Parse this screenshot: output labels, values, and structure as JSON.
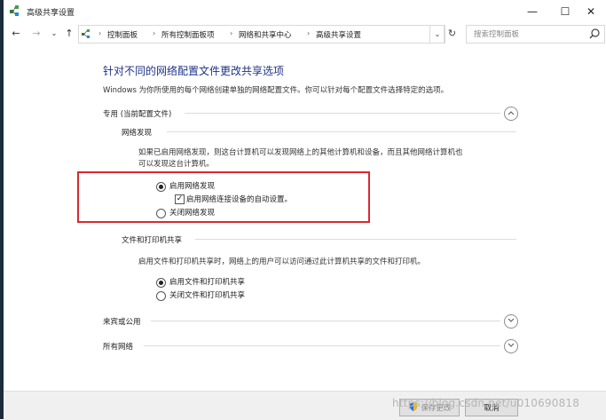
{
  "window": {
    "title": "高级共享设置",
    "controls": {
      "minimize": "—",
      "maximize": "☐",
      "close": "✕"
    }
  },
  "address_bar": {
    "breadcrumbs": [
      "控制面板",
      "所有控制面板项",
      "网络和共享中心",
      "高级共享设置"
    ],
    "search_placeholder": "搜索控制面板"
  },
  "main": {
    "heading": "针对不同的网络配置文件更改共享选项",
    "subheading": "Windows 为你所使用的每个网络创建单独的网络配置文件。你可以针对每个配置文件选择特定的选项。",
    "profiles": [
      {
        "label": "专用 (当前配置文件)",
        "expanded": true,
        "sections": [
          {
            "title": "网络发现",
            "description_line1": "如果已启用网络发现，则这台计算机可以发现网络上的其他计算机和设备，而且其他网络计算机也",
            "description_line2": "可以发现这台计算机。",
            "options": [
              {
                "label": "启用网络发现",
                "selected": true
              },
              {
                "label": "关闭网络发现",
                "selected": false
              }
            ],
            "checkbox": {
              "label": "启用网络连接设备的自动设置。",
              "checked": true
            }
          },
          {
            "title": "文件和打印机共享",
            "description_line1": "启用文件和打印机共享时，网络上的用户可以访问通过此计算机共享的文件和打印机。",
            "options": [
              {
                "label": "启用文件和打印机共享",
                "selected": true
              },
              {
                "label": "关闭文件和打印机共享",
                "selected": false
              }
            ]
          }
        ]
      },
      {
        "label": "来宾或公用",
        "expanded": false
      },
      {
        "label": "所有网络",
        "expanded": false
      }
    ]
  },
  "footer": {
    "save_label": "保存更改",
    "cancel_label": "取消"
  },
  "watermark": "https://blog.csdn.net/u010690818",
  "colors": {
    "heading": "#1e3287",
    "highlight_border": "#d9292f",
    "taskbar_strip": "#1b2c3c"
  }
}
